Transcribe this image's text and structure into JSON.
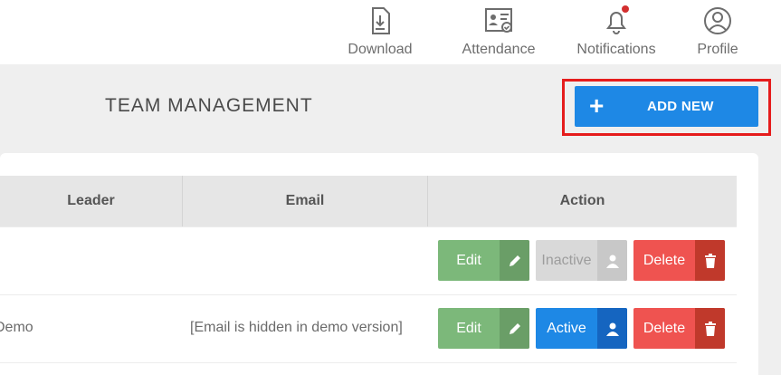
{
  "nav": {
    "download": "Download",
    "attendance": "Attendance",
    "notifications": "Notifications",
    "profile": "Profile"
  },
  "page": {
    "title": "TEAM MANAGEMENT",
    "add_button": "ADD NEW"
  },
  "table": {
    "columns": {
      "leader": "Leader",
      "email": "Email",
      "action": "Action"
    },
    "rows": [
      {
        "leader": "",
        "email": "",
        "edit": "Edit",
        "status": "Inactive",
        "status_state": "inactive",
        "delete": "Delete"
      },
      {
        "leader": "Demo",
        "email": "[Email is hidden in demo version]",
        "edit": "Edit",
        "status": "Active",
        "status_state": "active",
        "delete": "Delete"
      }
    ]
  },
  "colors": {
    "primary": "#1e88e5",
    "edit": "#7cb87a",
    "delete": "#ef5350",
    "highlight": "#e51c1c",
    "notification_dot": "#d32f2f"
  }
}
